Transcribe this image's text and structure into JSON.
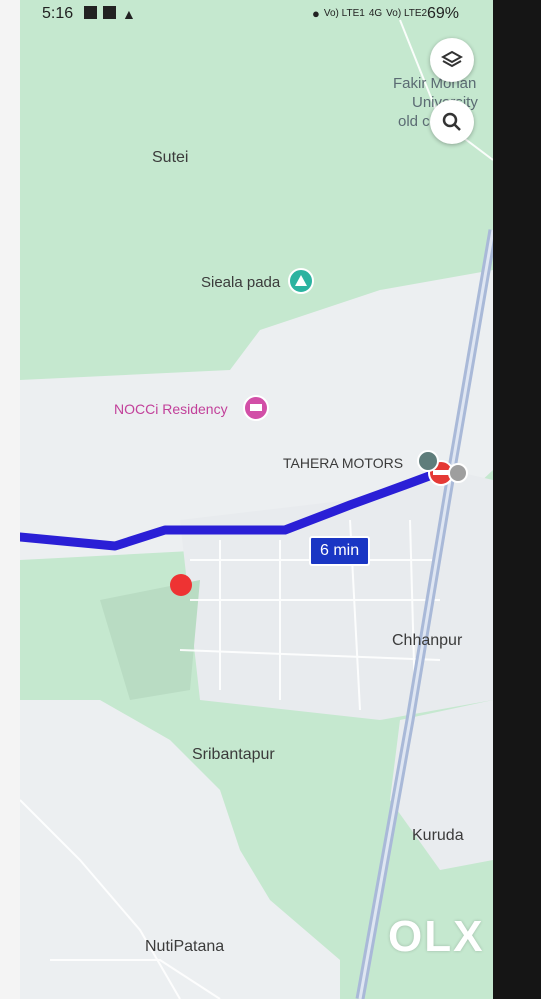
{
  "status_bar": {
    "time": "5:16",
    "battery": "69%",
    "net1": "Vo) LTE1",
    "net2": "Vo) LTE2",
    "net_type": "4G"
  },
  "map": {
    "places": {
      "fakir": "Fakir Mohan",
      "univ": "University",
      "old": "old c",
      "sutei": "Sutei",
      "sieala": "Sieala pada",
      "nocci": "NOCCi Residency",
      "tahera": "TAHERA MOTORS",
      "chhanpur": "Chhanpur",
      "sribantapur": "Sribantapur",
      "kuruda": "Kuruda",
      "nutipatana": "NutiPatana"
    },
    "route_time": "6 min"
  },
  "buttons": {
    "layers_icon": "layers-icon",
    "search_icon": "search-icon"
  },
  "watermark": "OLX",
  "colors": {
    "forest": "#c5e8cf",
    "urban": "#eceff1",
    "route": "#2a1fd6",
    "poi": "#c2409a",
    "dest": "#ee3333"
  }
}
